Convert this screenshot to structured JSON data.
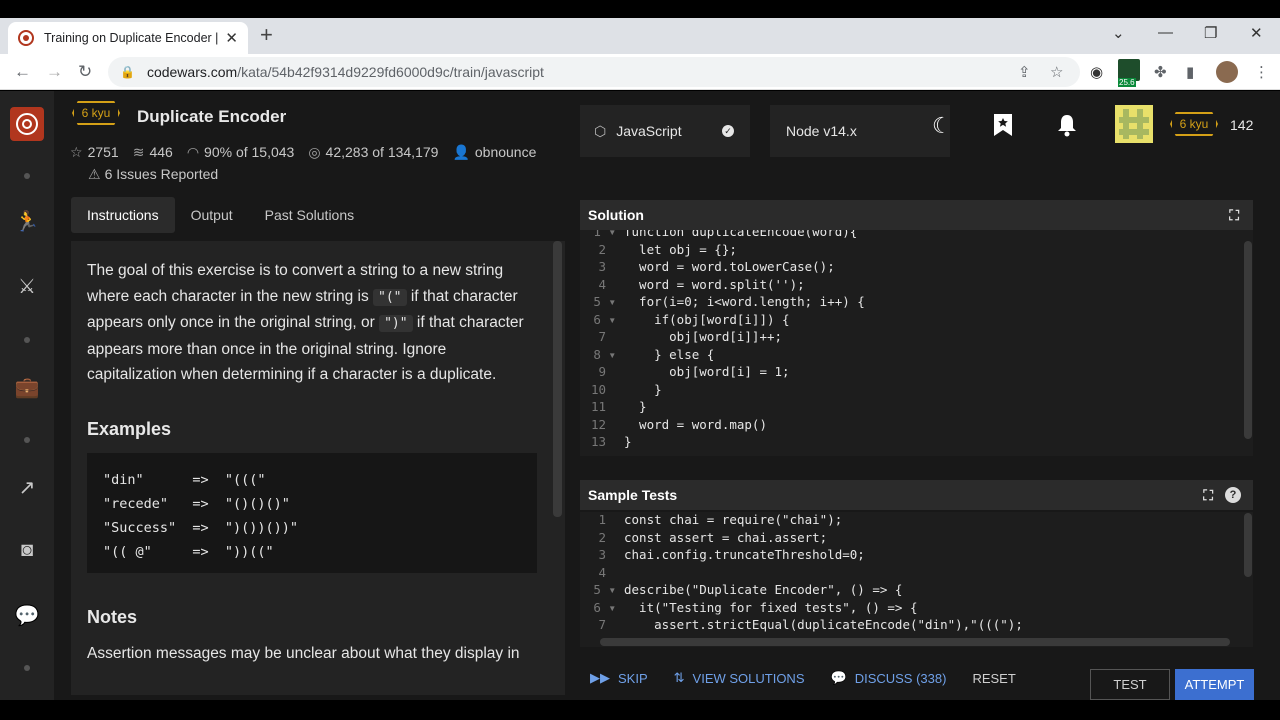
{
  "browser": {
    "tab_title": "Training on Duplicate Encoder | C",
    "url_host": "codewars.com",
    "url_path": "/kata/54b42f9314d9229fd6000d9c/train/javascript",
    "ext_badge": "25.6"
  },
  "kata": {
    "rank": "6 kyu",
    "title": "Duplicate Encoder",
    "stars": "2751",
    "collections": "446",
    "satisfaction": "90% of 15,043",
    "completed": "42,283 of 134,179",
    "author": "obnounce",
    "issues": "6 Issues Reported"
  },
  "left_tabs": [
    "Instructions",
    "Output",
    "Past Solutions"
  ],
  "description": {
    "p1_a": "The goal of this exercise is to convert a string to a new string where each character in the new string is ",
    "code1": "\"(\"",
    "p1_b": " if that character appears only once in the original string, or ",
    "code2": "\")\"",
    "p1_c": " if that character appears more than once in the original string. Ignore capitalization when determining if a character is a duplicate.",
    "examples_heading": "Examples",
    "examples": "\"din\"      =>  \"(((\"\n\"recede\"   =>  \"()()()\"\n\"Success\"  =>  \")())())\"\n\"(( @\"     =>  \"))((\"",
    "notes_heading": "Notes",
    "notes_text": "Assertion messages may be unclear about what they display in"
  },
  "header": {
    "language": "JavaScript",
    "runtime": "Node v14.x",
    "user_rank": "6 kyu",
    "honor": "142"
  },
  "solution": {
    "heading": "Solution",
    "lines": [
      "function duplicateEncode(word){",
      "  let obj = {};",
      "  word = word.toLowerCase();",
      "  word = word.split('');",
      "  for(i=0; i<word.length; i++) {",
      "    if(obj[word[i]]) {",
      "      obj[word[i]]++;",
      "    } else {",
      "      obj[word[i] = 1;",
      "    }",
      "  }",
      "  word = word.map()",
      "}"
    ]
  },
  "tests": {
    "heading": "Sample Tests",
    "lines": [
      "const chai = require(\"chai\");",
      "const assert = chai.assert;",
      "chai.config.truncateThreshold=0;",
      "",
      "describe(\"Duplicate Encoder\", () => {",
      "  it(\"Testing for fixed tests\", () => {",
      "    assert.strictEqual(duplicateEncode(\"din\"),\"(((\");"
    ]
  },
  "footer": {
    "skip": "SKIP",
    "view_solutions": "VIEW SOLUTIONS",
    "discuss": "DISCUSS (338)",
    "reset": "RESET",
    "test": "TEST",
    "attempt": "ATTEMPT"
  }
}
